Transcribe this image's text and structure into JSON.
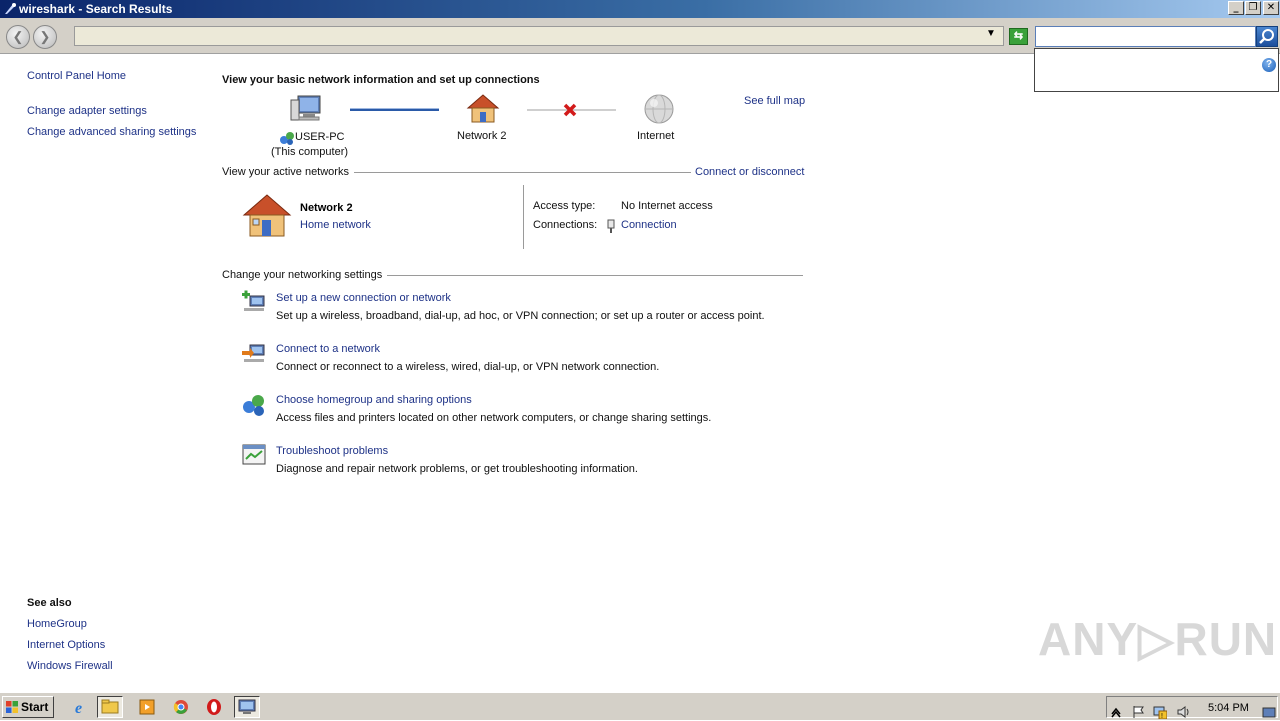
{
  "window": {
    "title": "wireshark - Search Results",
    "controls": {
      "minimize": "_",
      "restore": "❐",
      "close": "✕"
    }
  },
  "addressbar": {
    "back": "❮",
    "forward": "❯",
    "address": "",
    "dropdown": "▼",
    "refresh": "⇆",
    "search_value": "",
    "help": "?"
  },
  "sidebar": {
    "home": "Control Panel Home",
    "items": [
      {
        "label": "Change adapter settings"
      },
      {
        "label": "Change advanced sharing settings"
      }
    ],
    "see_also_title": "See also",
    "see_also": [
      {
        "label": "HomeGroup"
      },
      {
        "label": "Internet Options"
      },
      {
        "label": "Windows Firewall"
      }
    ]
  },
  "main": {
    "title": "View your basic network information and set up connections",
    "map": {
      "computer_name": "USER-PC",
      "computer_sub": "(This computer)",
      "network_name": "Network  2",
      "internet": "Internet",
      "see_full_map": "See full map"
    },
    "active_networks": {
      "heading": "View your active networks",
      "connect_link": "Connect or disconnect",
      "network_name": "Network  2",
      "network_type": "Home network",
      "access_type_label": "Access type:",
      "access_type_value": "No Internet access",
      "connections_label": "Connections:",
      "connections_value": "Connection"
    },
    "settings": {
      "heading": "Change your networking settings",
      "tasks": [
        {
          "title": "Set up a new connection or network",
          "desc": "Set up a wireless, broadband, dial-up, ad hoc, or VPN connection; or set up a router or access point."
        },
        {
          "title": "Connect to a network",
          "desc": "Connect or reconnect to a wireless, wired, dial-up, or VPN network connection."
        },
        {
          "title": "Choose homegroup and sharing options",
          "desc": "Access files and printers located on other network computers, or change sharing settings."
        },
        {
          "title": "Troubleshoot problems",
          "desc": "Diagnose and repair network problems, or get troubleshooting information."
        }
      ]
    }
  },
  "watermark": "ANY▷RUN",
  "taskbar": {
    "start": "Start",
    "apps": [
      "internet-explorer",
      "explorer",
      "media-player",
      "chrome",
      "opera",
      "network"
    ],
    "clock": "5:04 PM"
  },
  "colors": {
    "link": "#1e3287",
    "titlebar": "#0a246a"
  }
}
